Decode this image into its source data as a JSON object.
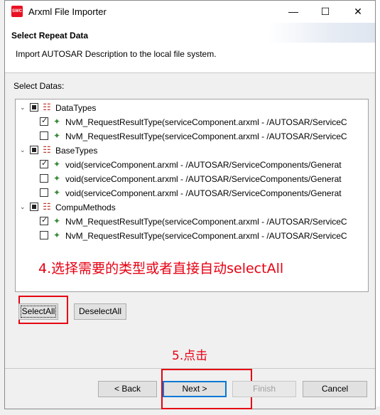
{
  "window": {
    "title": "Arxml File Importer",
    "icon_text": "SWC",
    "controls": {
      "minimize": "—",
      "maximize": "☐",
      "close": "✕"
    }
  },
  "header": {
    "title": "Select Repeat Data",
    "description": "Import AUTOSAR Description to the local file system."
  },
  "tree": {
    "label": "Select Datas:",
    "groups": [
      {
        "name": "DataTypes",
        "items": [
          {
            "text": "NvM_RequestResultType(serviceComponent.arxml - /AUTOSAR/ServiceC",
            "checked": true
          },
          {
            "text": "NvM_RequestResultType(serviceComponent.arxml - /AUTOSAR/ServiceC",
            "checked": false
          }
        ]
      },
      {
        "name": "BaseTypes",
        "items": [
          {
            "text": "void(serviceComponent.arxml - /AUTOSAR/ServiceComponents/Generat",
            "checked": true
          },
          {
            "text": "void(serviceComponent.arxml - /AUTOSAR/ServiceComponents/Generat",
            "checked": false
          },
          {
            "text": "void(serviceComponent.arxml - /AUTOSAR/ServiceComponents/Generat",
            "checked": false
          }
        ]
      },
      {
        "name": "CompuMethods",
        "items": [
          {
            "text": "NvM_RequestResultType(serviceComponent.arxml - /AUTOSAR/ServiceC",
            "checked": true
          },
          {
            "text": "NvM_RequestResultType(serviceComponent.arxml - /AUTOSAR/ServiceC",
            "checked": false
          }
        ]
      }
    ]
  },
  "buttons": {
    "select_all": "SelectAll",
    "deselect_all": "DeselectAll",
    "back": "< Back",
    "next": "Next >",
    "finish": "Finish",
    "cancel": "Cancel"
  },
  "annotations": {
    "step4": "4.选择需要的类型或者直接自动selectAll",
    "step5": "5.点击"
  },
  "colors": {
    "annotation": "#e60012",
    "accent": "#0078d7"
  }
}
